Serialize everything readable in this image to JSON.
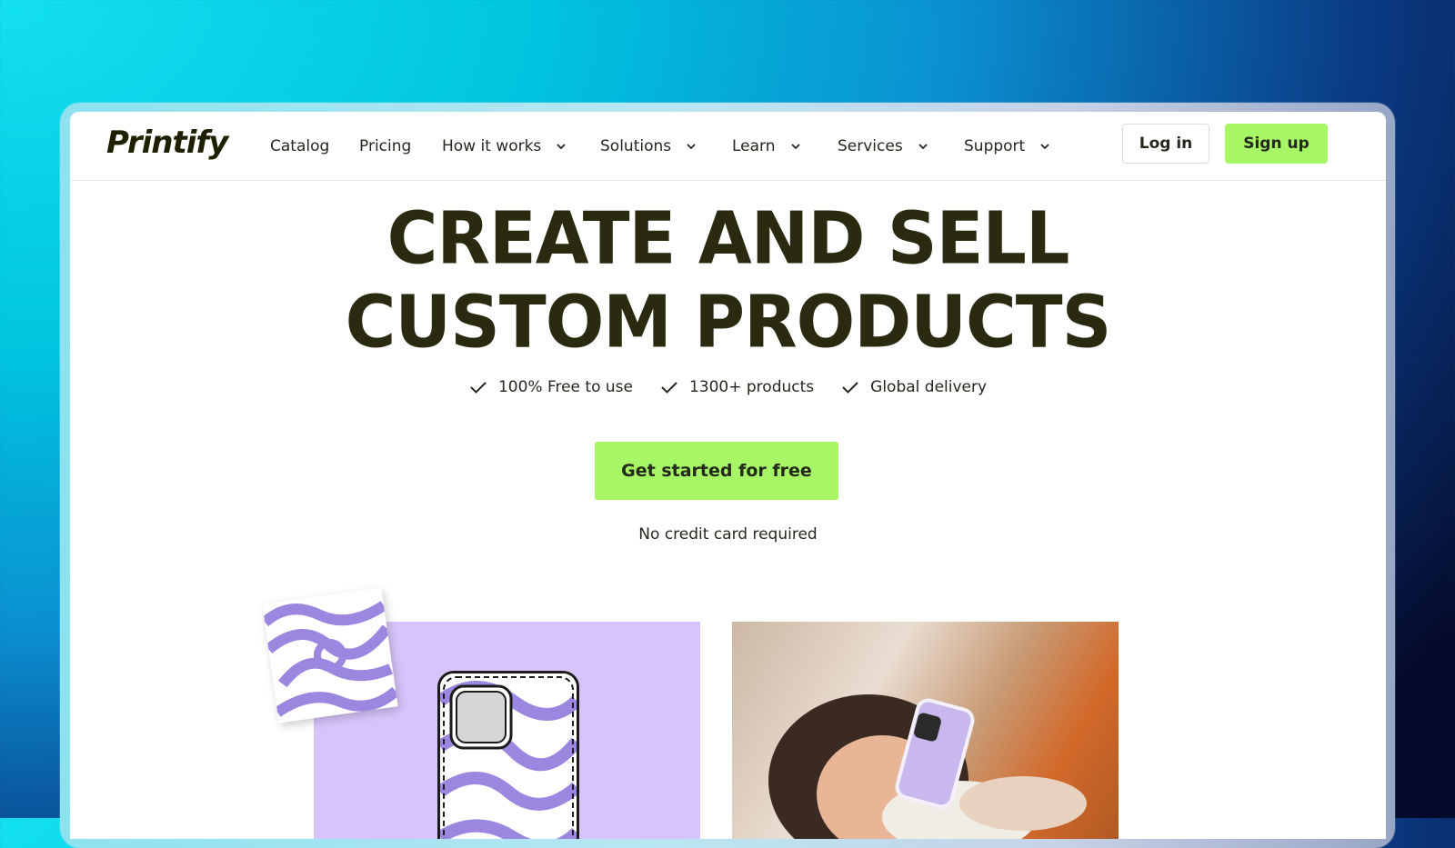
{
  "brand": {
    "logo_text": "Printify"
  },
  "nav": {
    "items": [
      {
        "label": "Catalog",
        "dropdown": false
      },
      {
        "label": "Pricing",
        "dropdown": false
      },
      {
        "label": "How it works",
        "dropdown": true
      },
      {
        "label": "Solutions",
        "dropdown": true
      },
      {
        "label": "Learn",
        "dropdown": true
      },
      {
        "label": "Services",
        "dropdown": true
      },
      {
        "label": "Support",
        "dropdown": true
      }
    ],
    "login_label": "Log in",
    "signup_label": "Sign up"
  },
  "hero": {
    "title_line1": "CREATE AND SELL",
    "title_line2": "CUSTOM PRODUCTS",
    "features": [
      "100% Free to use",
      "1300+ products",
      "Global delivery"
    ],
    "cta_label": "Get started for free",
    "subnote": "No credit card required"
  },
  "colors": {
    "accent_green": "#a6f666",
    "text_dark": "#25281d",
    "lavender": "#d8c4fb",
    "swirl_purple": "#9b86e0"
  },
  "icons": {
    "check": "check-icon",
    "chevron": "chevron-down-icon"
  }
}
